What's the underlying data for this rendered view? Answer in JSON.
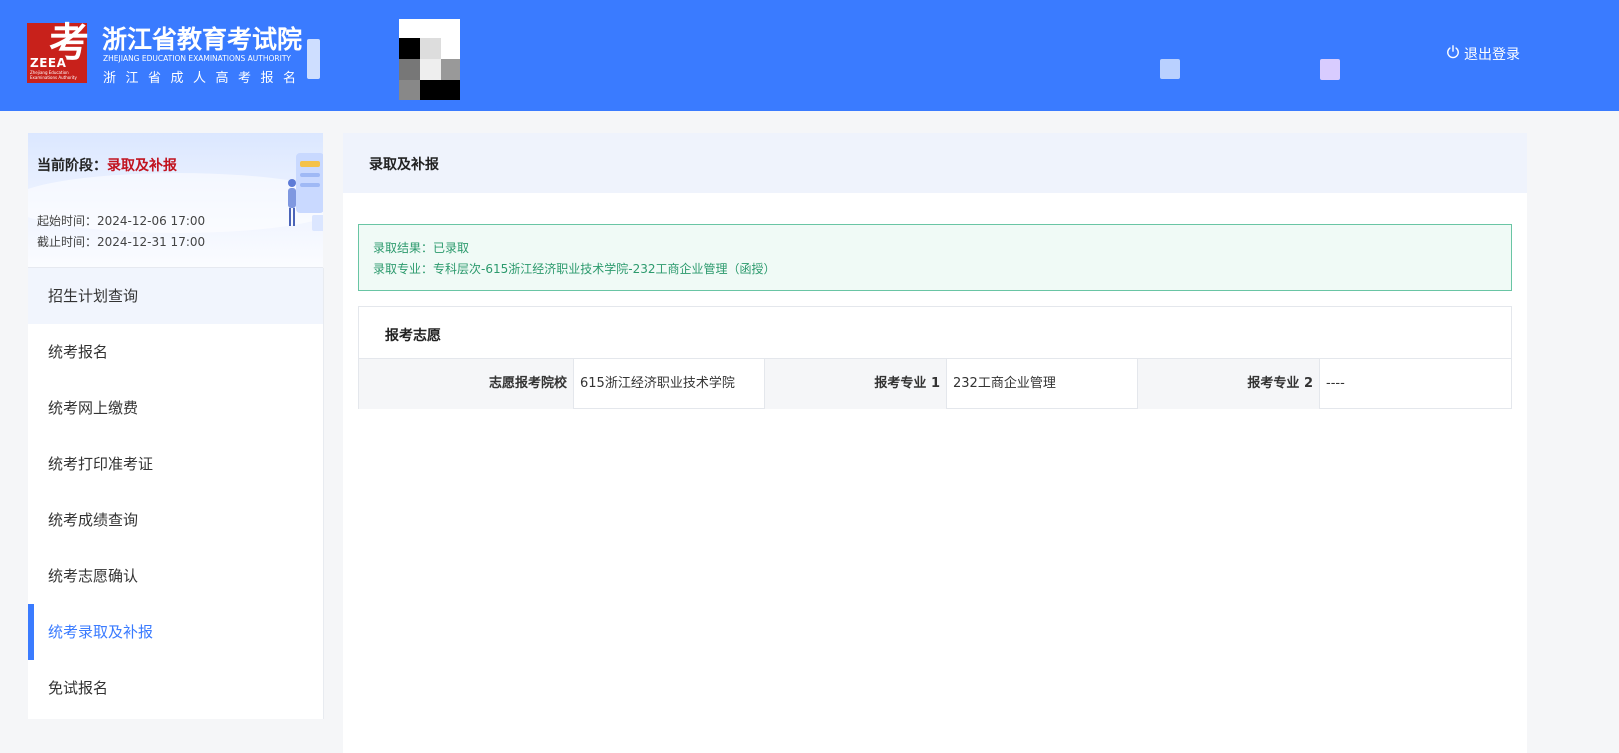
{
  "header": {
    "logo_char": "考",
    "logo_abbr": "ZEEA",
    "logo_sub": "Zhejiang Education Examinations Authority",
    "org_title": "浙江省教育考试院",
    "org_title_en": "ZHEJIANG EDUCATION EXAMINATIONS AUTHORITY",
    "org_subtitle": "浙江省成人高考报名",
    "logout_label": "退出登录",
    "logout_icon": "power-icon"
  },
  "stage": {
    "label": "当前阶段：",
    "value": "录取及补报",
    "start": "起始时间：2024-12-06 17:00",
    "end": "截止时间：2024-12-31 17:00"
  },
  "menu": [
    {
      "label": "招生计划查询"
    },
    {
      "label": "统考报名"
    },
    {
      "label": "统考网上缴费"
    },
    {
      "label": "统考打印准考证"
    },
    {
      "label": "统考成绩查询"
    },
    {
      "label": "统考志愿确认"
    },
    {
      "label": "统考录取及补报"
    },
    {
      "label": "免试报名"
    }
  ],
  "main": {
    "title": "录取及补报",
    "result_line": "录取结果：已录取",
    "major_line": "录取专业：专科层次-615浙江经济职业技术学院-232工商企业管理（函授）",
    "wish_title": "报考志愿",
    "wish_table": [
      {
        "label": "志愿报考院校",
        "value": "615浙江经济职业技术学院"
      },
      {
        "label": "报考专业 1",
        "value": "232工商企业管理"
      },
      {
        "label": "报考专业 2",
        "value": "----"
      }
    ]
  },
  "colors": {
    "brand_blue": "#3a7bff",
    "logo_red": "#c8211b",
    "stage_red": "#c1121f",
    "success_green": "#2c9a6d"
  }
}
